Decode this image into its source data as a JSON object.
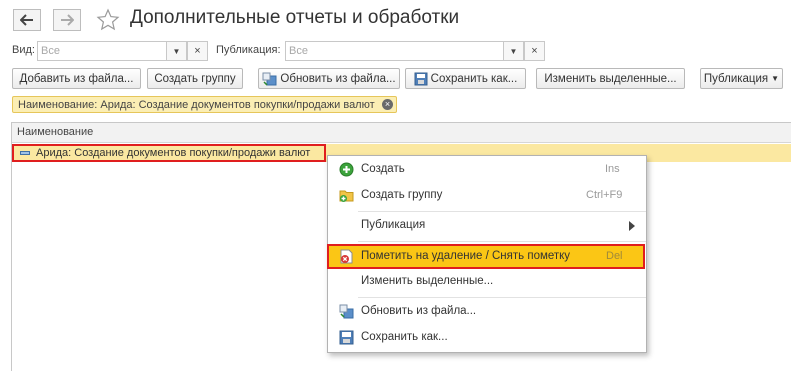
{
  "header": {
    "title": "Дополнительные отчеты и обработки"
  },
  "filters": {
    "kind": {
      "label": "Вид:",
      "placeholder": "Все"
    },
    "publication": {
      "label": "Публикация:",
      "placeholder": "Все"
    }
  },
  "toolbar": {
    "add_from_file": "Добавить из файла...",
    "create_group": "Создать группу",
    "update_from_file": "Обновить из файла...",
    "save_as": "Сохранить как...",
    "edit_selected": "Изменить выделенные...",
    "publication": "Публикация"
  },
  "filter_tag": {
    "text": "Наименование: Арида: Создание документов покупки/продажи валют"
  },
  "list": {
    "column_header": "Наименование",
    "rows": [
      {
        "name": "Арида: Создание документов покупки/продажи валют"
      }
    ]
  },
  "context_menu": {
    "items": [
      {
        "label": "Создать",
        "shortcut": "Ins"
      },
      {
        "label": "Создать группу",
        "shortcut": "Ctrl+F9"
      },
      {
        "label": "Публикация",
        "shortcut": ""
      },
      {
        "label": "Пометить на удаление / Снять пометку",
        "shortcut": "Del"
      },
      {
        "label": "Изменить выделенные...",
        "shortcut": ""
      },
      {
        "label": "Обновить из файла...",
        "shortcut": ""
      },
      {
        "label": "Сохранить как...",
        "shortcut": ""
      }
    ]
  },
  "colors": {
    "selection": "#fbc615",
    "highlight_outline": "#e01e1e",
    "tag_background": "#fbeeb4"
  }
}
